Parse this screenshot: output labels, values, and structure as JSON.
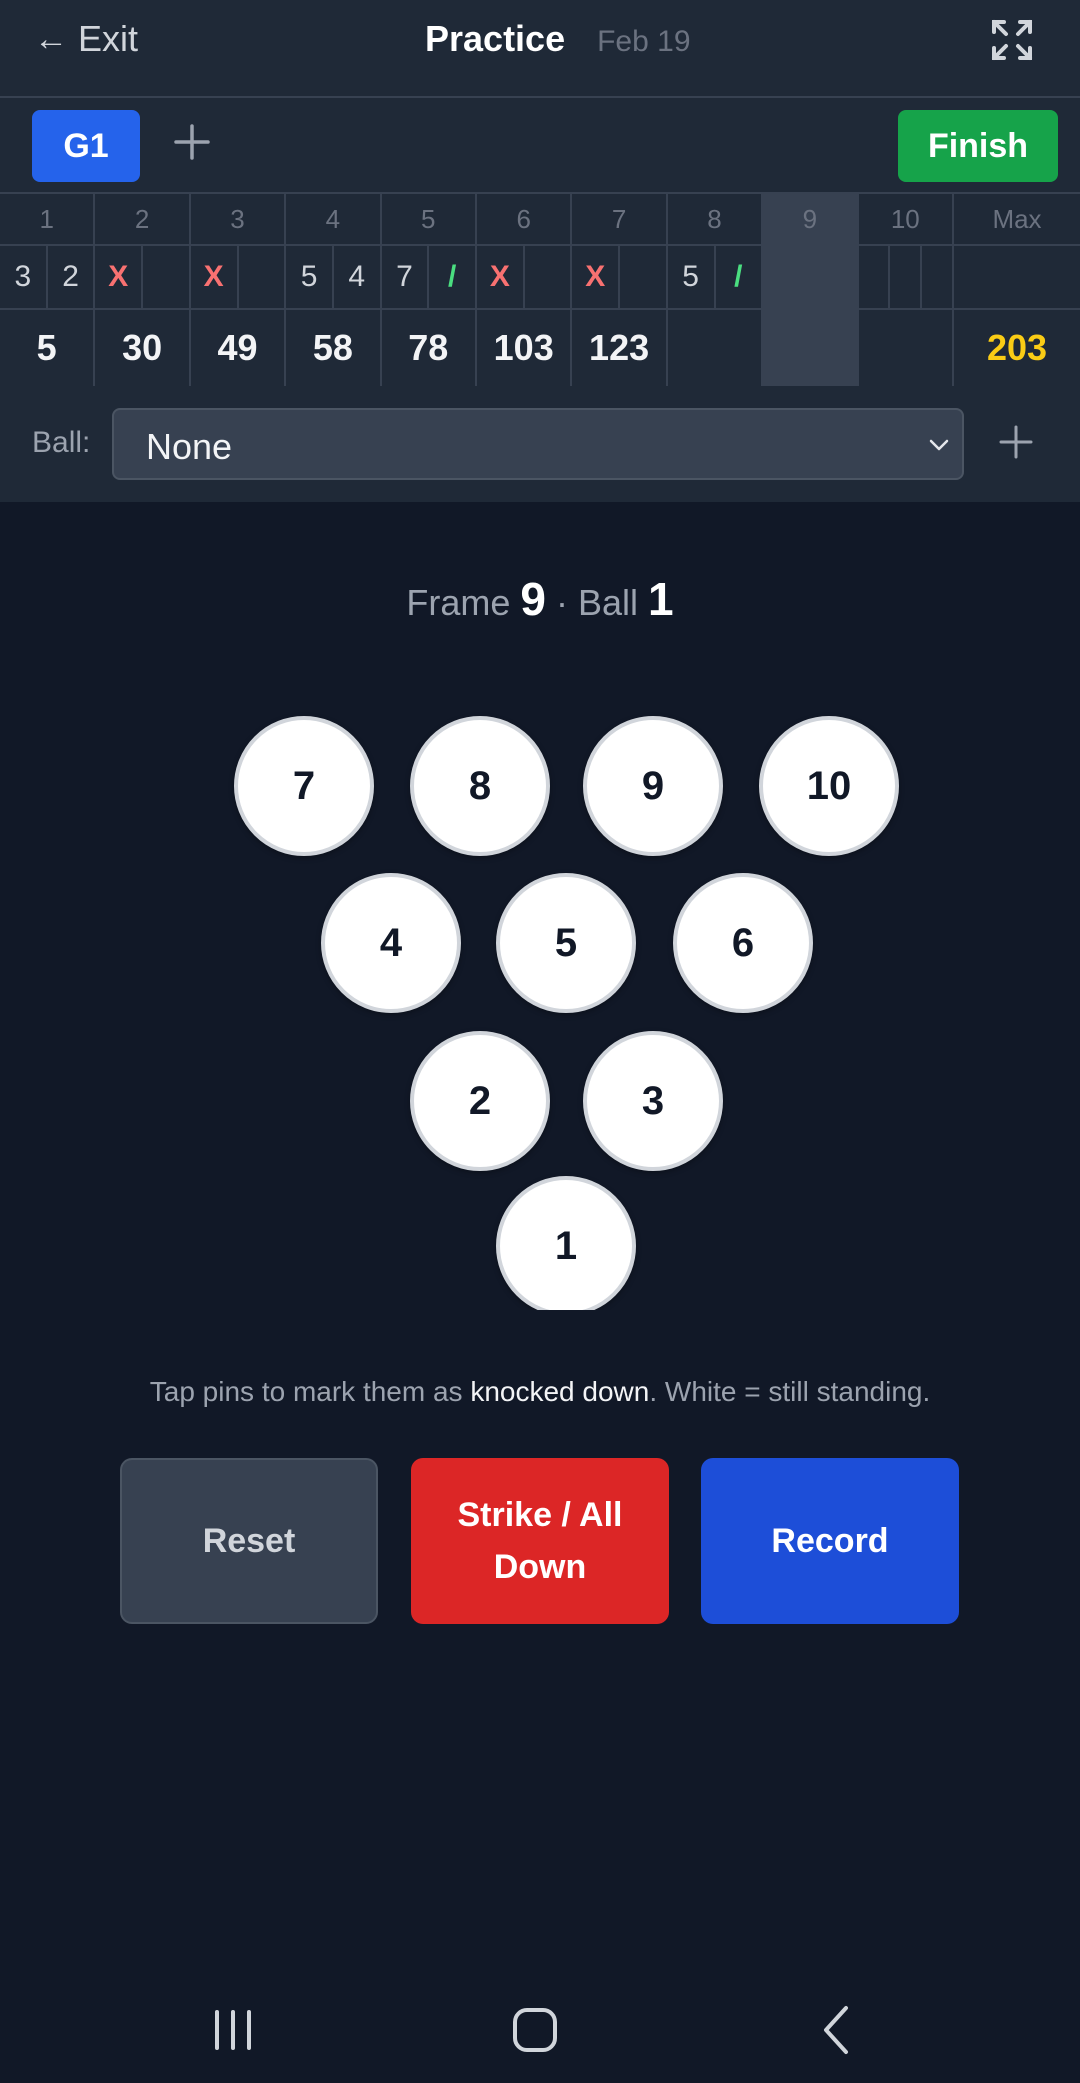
{
  "header": {
    "exit_arrow": "←",
    "exit_label": "Exit",
    "title": "Practice",
    "date": "Feb 19",
    "fullscreen_icon": "expand-icon"
  },
  "games": {
    "tabs": [
      {
        "label": "G1"
      }
    ],
    "add_icon": "plus-icon",
    "finish_label": "Finish"
  },
  "scoreboard": {
    "frames": [
      {
        "number": "1",
        "balls": [
          "3",
          "2"
        ],
        "total": "5"
      },
      {
        "number": "2",
        "balls": [
          "X",
          ""
        ],
        "total": "30"
      },
      {
        "number": "3",
        "balls": [
          "X",
          ""
        ],
        "total": "49"
      },
      {
        "number": "4",
        "balls": [
          "5",
          "4"
        ],
        "total": "58"
      },
      {
        "number": "5",
        "balls": [
          "7",
          "/"
        ],
        "total": "78"
      },
      {
        "number": "6",
        "balls": [
          "X",
          ""
        ],
        "total": "103"
      },
      {
        "number": "7",
        "balls": [
          "X",
          ""
        ],
        "total": "123"
      },
      {
        "number": "8",
        "balls": [
          "5",
          "/"
        ],
        "total": ""
      },
      {
        "number": "9",
        "balls": [],
        "total": ""
      },
      {
        "number": "10",
        "balls": [
          "",
          "",
          ""
        ],
        "total": ""
      }
    ],
    "current_frame": 9,
    "max_label": "Max",
    "max_score": "203"
  },
  "ball": {
    "label": "Ball:",
    "selected": "None"
  },
  "frame_indicator": {
    "frame_label": "Frame",
    "frame": "9",
    "separator": "·",
    "ball_label": "Ball",
    "ball": "1"
  },
  "pins": [
    "1",
    "2",
    "3",
    "4",
    "5",
    "6",
    "7",
    "8",
    "9",
    "10"
  ],
  "hint": {
    "before": "Tap pins to mark them as ",
    "emphasis": "knocked down",
    "after": ". White = still standing."
  },
  "actions": {
    "reset_label": "Reset",
    "strike_label": "Strike / All Down",
    "record_label": "Record"
  },
  "colors": {
    "background": "#111827",
    "panel": "#1f2937",
    "accent_blue": "#2563eb",
    "finish_green": "#16a34a",
    "strike_red": "#dc2626",
    "max_gold": "#facc15",
    "strike_mark": "#f87171",
    "spare_mark": "#4ade80"
  }
}
